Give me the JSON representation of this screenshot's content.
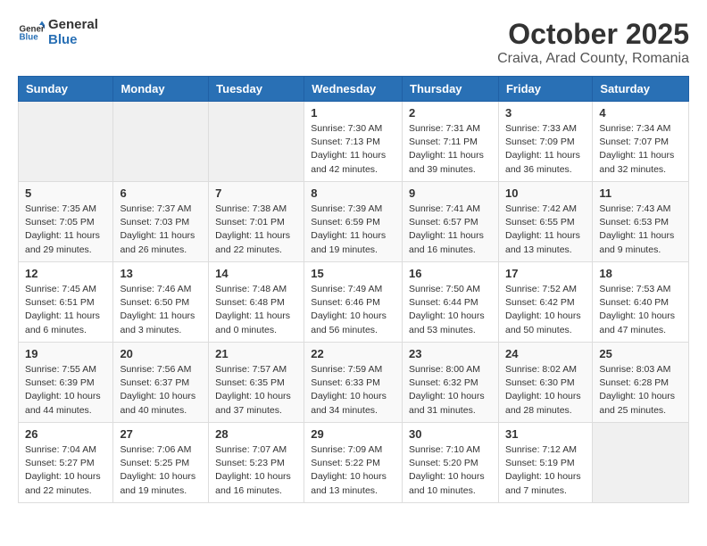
{
  "header": {
    "logo_general": "General",
    "logo_blue": "Blue",
    "month": "October 2025",
    "location": "Craiva, Arad County, Romania"
  },
  "days_of_week": [
    "Sunday",
    "Monday",
    "Tuesday",
    "Wednesday",
    "Thursday",
    "Friday",
    "Saturday"
  ],
  "weeks": [
    [
      {
        "day": "",
        "info": ""
      },
      {
        "day": "",
        "info": ""
      },
      {
        "day": "",
        "info": ""
      },
      {
        "day": "1",
        "info": "Sunrise: 7:30 AM\nSunset: 7:13 PM\nDaylight: 11 hours\nand 42 minutes."
      },
      {
        "day": "2",
        "info": "Sunrise: 7:31 AM\nSunset: 7:11 PM\nDaylight: 11 hours\nand 39 minutes."
      },
      {
        "day": "3",
        "info": "Sunrise: 7:33 AM\nSunset: 7:09 PM\nDaylight: 11 hours\nand 36 minutes."
      },
      {
        "day": "4",
        "info": "Sunrise: 7:34 AM\nSunset: 7:07 PM\nDaylight: 11 hours\nand 32 minutes."
      }
    ],
    [
      {
        "day": "5",
        "info": "Sunrise: 7:35 AM\nSunset: 7:05 PM\nDaylight: 11 hours\nand 29 minutes."
      },
      {
        "day": "6",
        "info": "Sunrise: 7:37 AM\nSunset: 7:03 PM\nDaylight: 11 hours\nand 26 minutes."
      },
      {
        "day": "7",
        "info": "Sunrise: 7:38 AM\nSunset: 7:01 PM\nDaylight: 11 hours\nand 22 minutes."
      },
      {
        "day": "8",
        "info": "Sunrise: 7:39 AM\nSunset: 6:59 PM\nDaylight: 11 hours\nand 19 minutes."
      },
      {
        "day": "9",
        "info": "Sunrise: 7:41 AM\nSunset: 6:57 PM\nDaylight: 11 hours\nand 16 minutes."
      },
      {
        "day": "10",
        "info": "Sunrise: 7:42 AM\nSunset: 6:55 PM\nDaylight: 11 hours\nand 13 minutes."
      },
      {
        "day": "11",
        "info": "Sunrise: 7:43 AM\nSunset: 6:53 PM\nDaylight: 11 hours\nand 9 minutes."
      }
    ],
    [
      {
        "day": "12",
        "info": "Sunrise: 7:45 AM\nSunset: 6:51 PM\nDaylight: 11 hours\nand 6 minutes."
      },
      {
        "day": "13",
        "info": "Sunrise: 7:46 AM\nSunset: 6:50 PM\nDaylight: 11 hours\nand 3 minutes."
      },
      {
        "day": "14",
        "info": "Sunrise: 7:48 AM\nSunset: 6:48 PM\nDaylight: 11 hours\nand 0 minutes."
      },
      {
        "day": "15",
        "info": "Sunrise: 7:49 AM\nSunset: 6:46 PM\nDaylight: 10 hours\nand 56 minutes."
      },
      {
        "day": "16",
        "info": "Sunrise: 7:50 AM\nSunset: 6:44 PM\nDaylight: 10 hours\nand 53 minutes."
      },
      {
        "day": "17",
        "info": "Sunrise: 7:52 AM\nSunset: 6:42 PM\nDaylight: 10 hours\nand 50 minutes."
      },
      {
        "day": "18",
        "info": "Sunrise: 7:53 AM\nSunset: 6:40 PM\nDaylight: 10 hours\nand 47 minutes."
      }
    ],
    [
      {
        "day": "19",
        "info": "Sunrise: 7:55 AM\nSunset: 6:39 PM\nDaylight: 10 hours\nand 44 minutes."
      },
      {
        "day": "20",
        "info": "Sunrise: 7:56 AM\nSunset: 6:37 PM\nDaylight: 10 hours\nand 40 minutes."
      },
      {
        "day": "21",
        "info": "Sunrise: 7:57 AM\nSunset: 6:35 PM\nDaylight: 10 hours\nand 37 minutes."
      },
      {
        "day": "22",
        "info": "Sunrise: 7:59 AM\nSunset: 6:33 PM\nDaylight: 10 hours\nand 34 minutes."
      },
      {
        "day": "23",
        "info": "Sunrise: 8:00 AM\nSunset: 6:32 PM\nDaylight: 10 hours\nand 31 minutes."
      },
      {
        "day": "24",
        "info": "Sunrise: 8:02 AM\nSunset: 6:30 PM\nDaylight: 10 hours\nand 28 minutes."
      },
      {
        "day": "25",
        "info": "Sunrise: 8:03 AM\nSunset: 6:28 PM\nDaylight: 10 hours\nand 25 minutes."
      }
    ],
    [
      {
        "day": "26",
        "info": "Sunrise: 7:04 AM\nSunset: 5:27 PM\nDaylight: 10 hours\nand 22 minutes."
      },
      {
        "day": "27",
        "info": "Sunrise: 7:06 AM\nSunset: 5:25 PM\nDaylight: 10 hours\nand 19 minutes."
      },
      {
        "day": "28",
        "info": "Sunrise: 7:07 AM\nSunset: 5:23 PM\nDaylight: 10 hours\nand 16 minutes."
      },
      {
        "day": "29",
        "info": "Sunrise: 7:09 AM\nSunset: 5:22 PM\nDaylight: 10 hours\nand 13 minutes."
      },
      {
        "day": "30",
        "info": "Sunrise: 7:10 AM\nSunset: 5:20 PM\nDaylight: 10 hours\nand 10 minutes."
      },
      {
        "day": "31",
        "info": "Sunrise: 7:12 AM\nSunset: 5:19 PM\nDaylight: 10 hours\nand 7 minutes."
      },
      {
        "day": "",
        "info": ""
      }
    ]
  ]
}
